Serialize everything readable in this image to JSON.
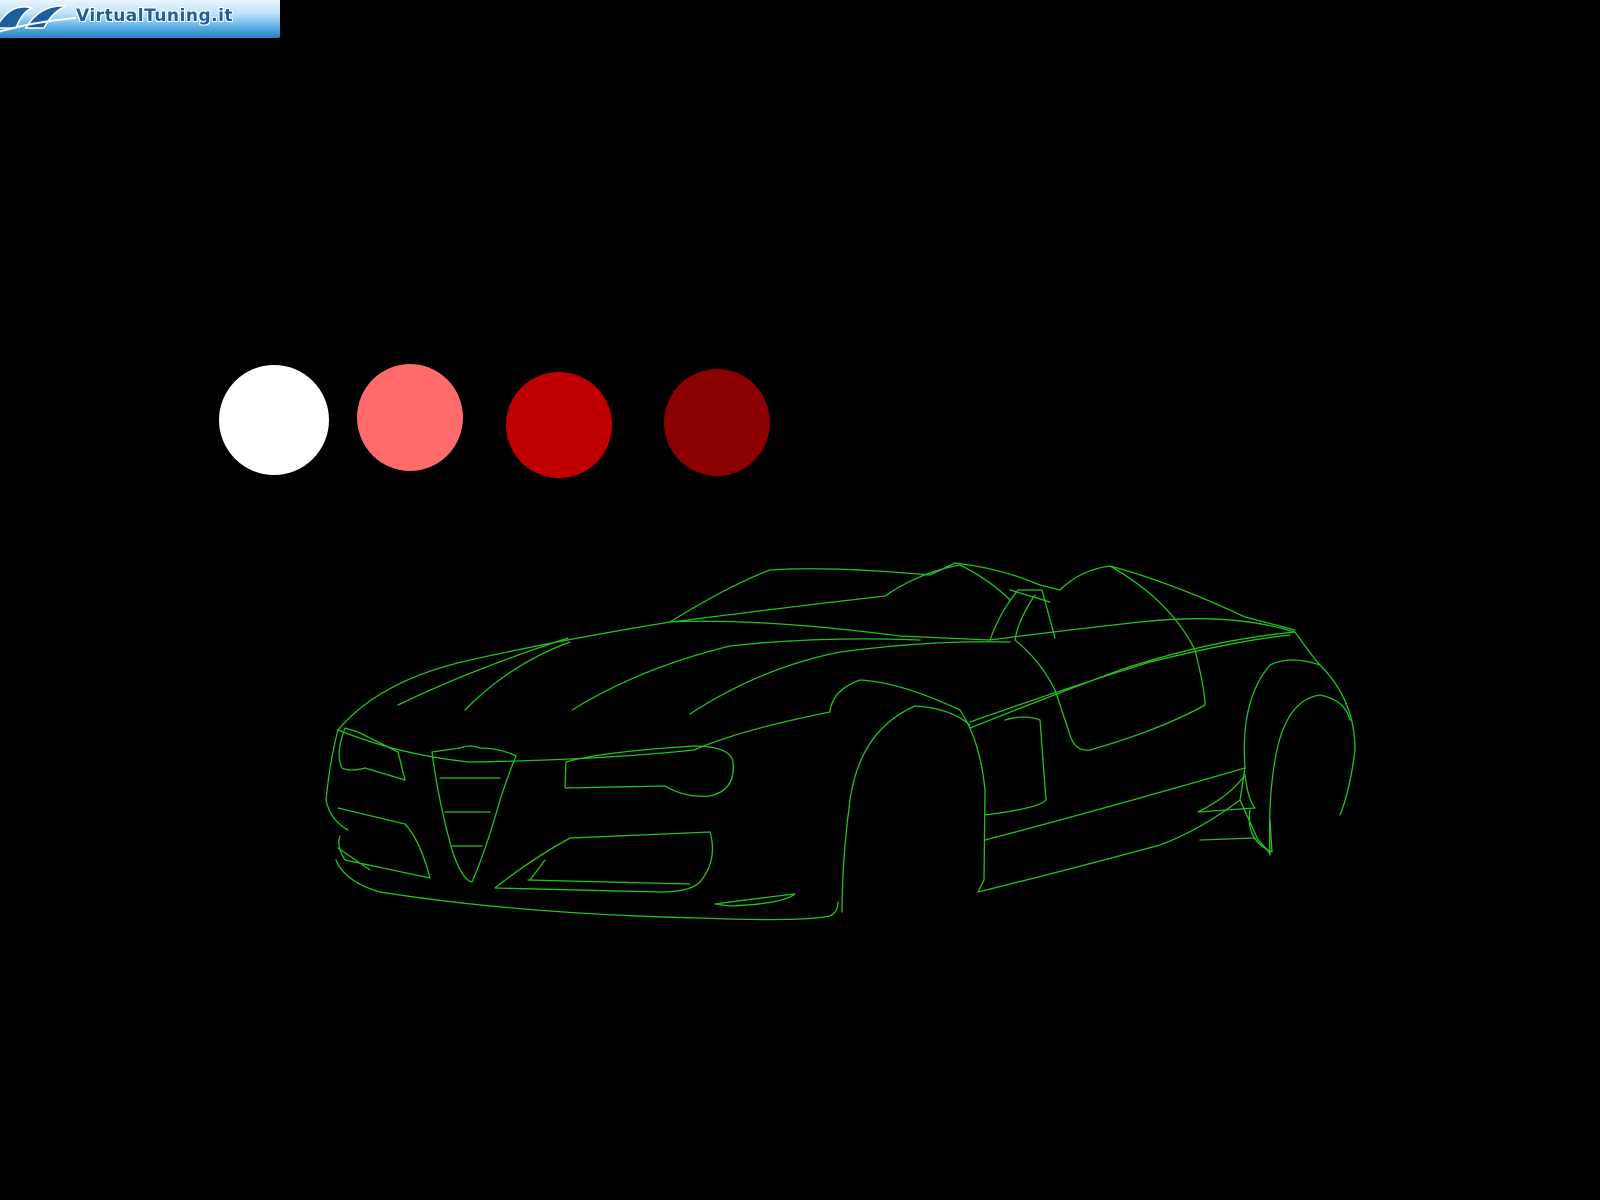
{
  "logo": {
    "text": "VirtualTuning.it"
  },
  "swatches": [
    {
      "name": "white",
      "color": "#ffffff"
    },
    {
      "name": "light-red",
      "color": "#ff6b6b"
    },
    {
      "name": "red",
      "color": "#c00000"
    },
    {
      "name": "dark-red",
      "color": "#8b0000"
    }
  ],
  "outline_color": "#22c21c",
  "background_color": "#000000"
}
